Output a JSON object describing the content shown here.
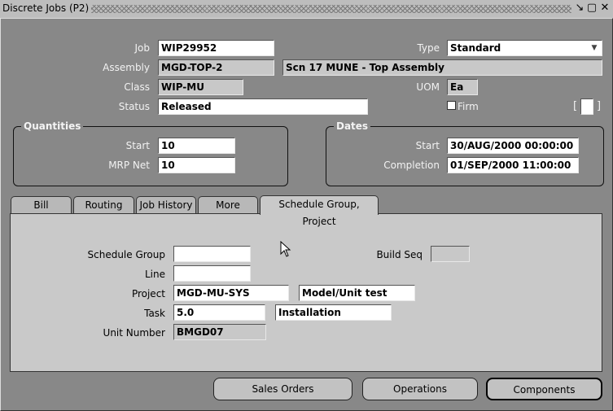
{
  "window": {
    "title": "Discrete Jobs (P2)"
  },
  "header": {
    "job_label": "Job",
    "job_value": "WIP29952",
    "type_label": "Type",
    "type_value": "Standard",
    "assembly_label": "Assembly",
    "assembly_value": "MGD-TOP-2",
    "assembly_desc": "Scn 17 MUNE - Top Assembly",
    "class_label": "Class",
    "class_value": "WIP-MU",
    "uom_label": "UOM",
    "uom_value": "Ea",
    "status_label": "Status",
    "status_value": "Released",
    "firm_label": "Firm",
    "bracket": "[",
    "bracket_close": "]"
  },
  "quantities": {
    "title": "Quantities",
    "start_label": "Start",
    "start_value": "10",
    "mrp_label": "MRP Net",
    "mrp_value": "10"
  },
  "dates": {
    "title": "Dates",
    "start_label": "Start",
    "start_value": "30/AUG/2000 00:00:00",
    "completion_label": "Completion",
    "completion_value": "01/SEP/2000 11:00:00"
  },
  "tabs": [
    {
      "label": "Bill"
    },
    {
      "label": "Routing"
    },
    {
      "label": "Job History"
    },
    {
      "label": "More"
    },
    {
      "label": "Schedule Group, Project"
    }
  ],
  "panel": {
    "schedule_group_label": "Schedule Group",
    "schedule_group_value": "",
    "build_seq_label": "Build Seq",
    "build_seq_value": "",
    "line_label": "Line",
    "line_value": "",
    "project_label": "Project",
    "project_value": "MGD-MU-SYS",
    "project_desc": "Model/Unit test",
    "task_label": "Task",
    "task_value": "5.0",
    "task_desc": "Installation",
    "unit_number_label": "Unit Number",
    "unit_number_value": "BMGD07"
  },
  "buttons": {
    "sales_orders": "Sales Orders",
    "operations": "Operations",
    "components": "Components"
  }
}
